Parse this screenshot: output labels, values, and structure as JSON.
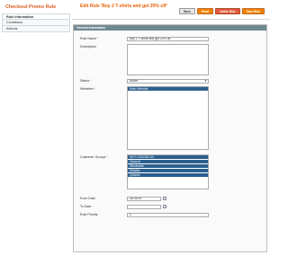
{
  "sidebar": {
    "title": "Checkout Promo Rule",
    "tabs": [
      {
        "label": "Rule Information",
        "active": true
      },
      {
        "label": "Conditions",
        "active": false
      },
      {
        "label": "Actions",
        "active": false
      }
    ]
  },
  "page_title": "Edit Rule 'Buy 2 T-shirts and get 20% off'",
  "buttons": {
    "back": "Back",
    "reset": "Reset",
    "delete": "Delete Rule",
    "save": "Save Rule"
  },
  "section_title": "General Information",
  "form": {
    "rule_name_label": "Rule Name",
    "rule_name_value": "Buy 2 T-shirts and get 20% off",
    "description_label": "Description",
    "status_label": "Status",
    "status_value": "Active",
    "websites_label": "Websites",
    "websites": [
      "Main Website"
    ],
    "customer_groups_label": "Customer Groups",
    "customer_groups": [
      "NOT LOGGED IN",
      "General",
      "Wholesale",
      "Retailer",
      "QAAAA"
    ],
    "from_date_label": "From Date",
    "from_date_value": "08.05.09",
    "to_date_label": "To Date",
    "to_date_value": "",
    "priority_label": "Rule Priority",
    "priority_value": "0",
    "required_mark": "*"
  },
  "colors": {
    "accent": "#eb5e00",
    "section_header": "#6f8992",
    "selected_option": "#2a5f8e"
  }
}
